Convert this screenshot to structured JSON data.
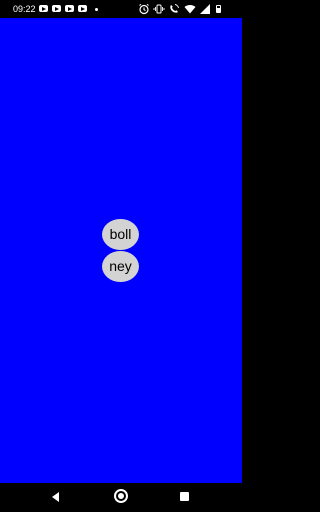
{
  "status_bar": {
    "time": "09:22",
    "notification_icons": [
      "youtube-icon",
      "youtube-icon",
      "youtube-icon",
      "youtube-icon"
    ],
    "system_icons": [
      "alarm-icon",
      "vibrate-icon",
      "call-wifi-icon",
      "wifi-icon",
      "signal-icon",
      "battery-icon"
    ]
  },
  "app": {
    "background_color": "#0000ff",
    "bubbles": [
      {
        "label": "boll"
      },
      {
        "label": "ney"
      }
    ],
    "bubble_color": "#d3d3d3"
  },
  "nav_bar": {
    "buttons": [
      "back-icon",
      "home-icon",
      "recents-icon"
    ]
  }
}
